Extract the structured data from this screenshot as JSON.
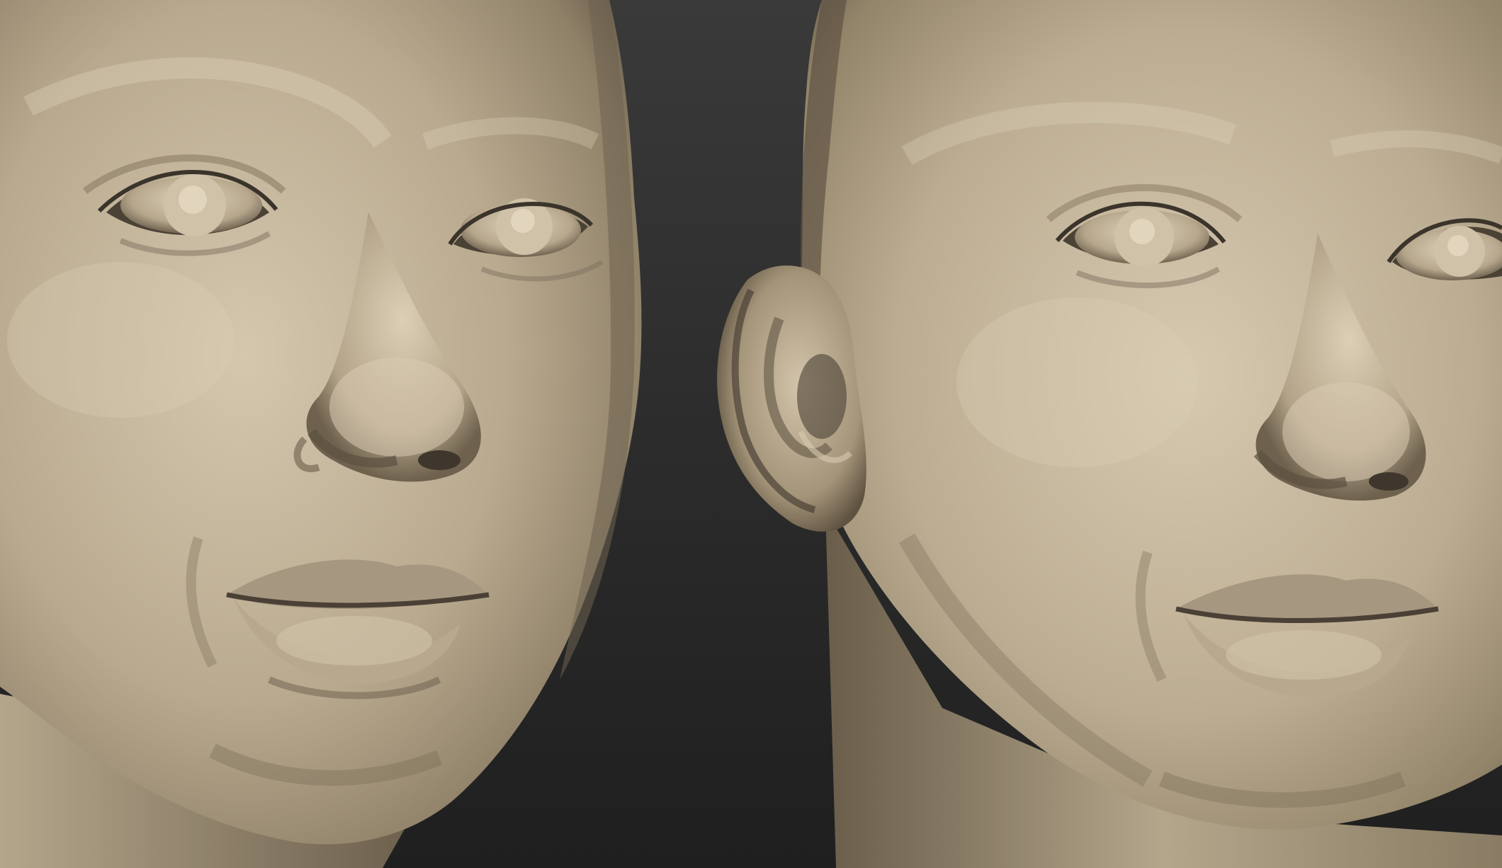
{
  "scene": {
    "description_hidden": "",
    "panels": [
      {
        "id": "left",
        "subject": "sculpted-face-three-quarter"
      },
      {
        "id": "right",
        "subject": "sculpted-head-with-ear"
      }
    ],
    "colors": {
      "background_top": "#3a3a3a",
      "background_bottom": "#1f1f1f",
      "clay_light": "#cdbfa6",
      "clay_mid": "#a99a80",
      "clay_dark": "#5f5443",
      "clay_shadow": "#3c342a"
    }
  }
}
